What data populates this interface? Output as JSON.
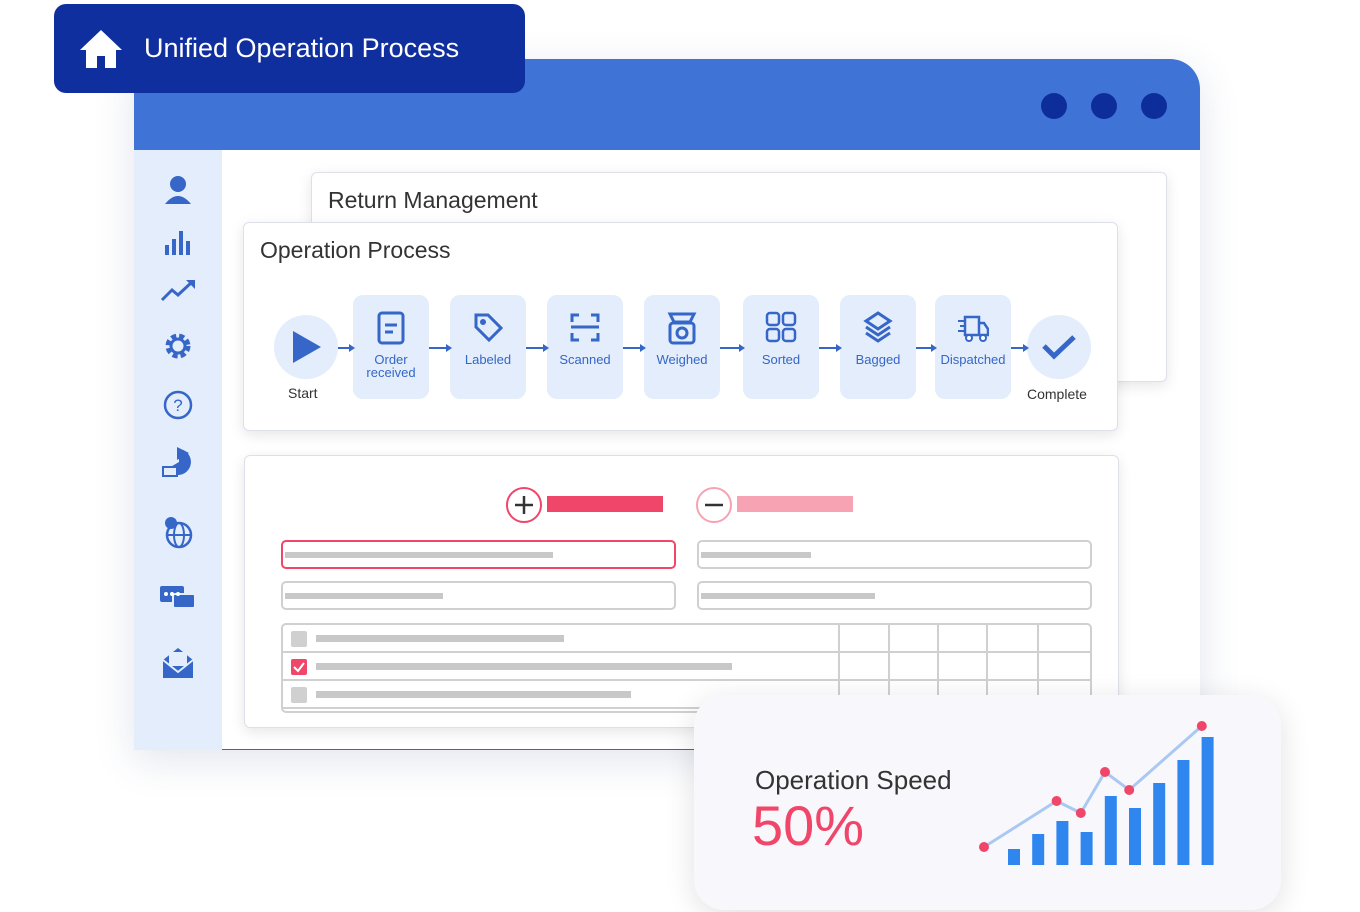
{
  "badge": {
    "title": "Unified Operation Process",
    "icon": "home-icon"
  },
  "window": {
    "header_color": "#3f74d6",
    "dots": 3
  },
  "sidebar": {
    "icons": [
      "user-icon",
      "bar-chart-icon",
      "trend-icon",
      "gear-icon",
      "help-icon",
      "pie-chart-icon",
      "globe-location-icon",
      "chat-icon",
      "mail-icon"
    ]
  },
  "return_card": {
    "title": "Return Management"
  },
  "process_card": {
    "title": "Operation Process",
    "start": "Start",
    "complete": "Complete",
    "steps": [
      {
        "label": "Order received",
        "icon": "document-icon"
      },
      {
        "label": "Labeled",
        "icon": "tag-icon"
      },
      {
        "label": "Scanned",
        "icon": "scan-icon"
      },
      {
        "label": "Weighed",
        "icon": "scale-icon"
      },
      {
        "label": "Sorted",
        "icon": "grid-icon"
      },
      {
        "label": "Bagged",
        "icon": "layers-icon"
      },
      {
        "label": "Dispatched",
        "icon": "truck-icon"
      }
    ]
  },
  "form_card": {
    "add_icon": "plus-circle-icon",
    "remove_icon": "minus-circle-icon",
    "accent": "#f0466a",
    "checked_rows": [
      false,
      true,
      false
    ]
  },
  "speed": {
    "label": "Operation Speed",
    "value": "50%",
    "chart_data": {
      "type": "bar",
      "bars": [
        16,
        31,
        44,
        33,
        69,
        57,
        82,
        105,
        128
      ],
      "line": [
        [
          0,
          18
        ],
        [
          3,
          64
        ],
        [
          4,
          52
        ],
        [
          5,
          93
        ],
        [
          6,
          75
        ],
        [
          9,
          139
        ]
      ],
      "bar_color": "#2f86ef",
      "line_color": "#a9c9f2",
      "point_color": "#f0466a"
    }
  }
}
